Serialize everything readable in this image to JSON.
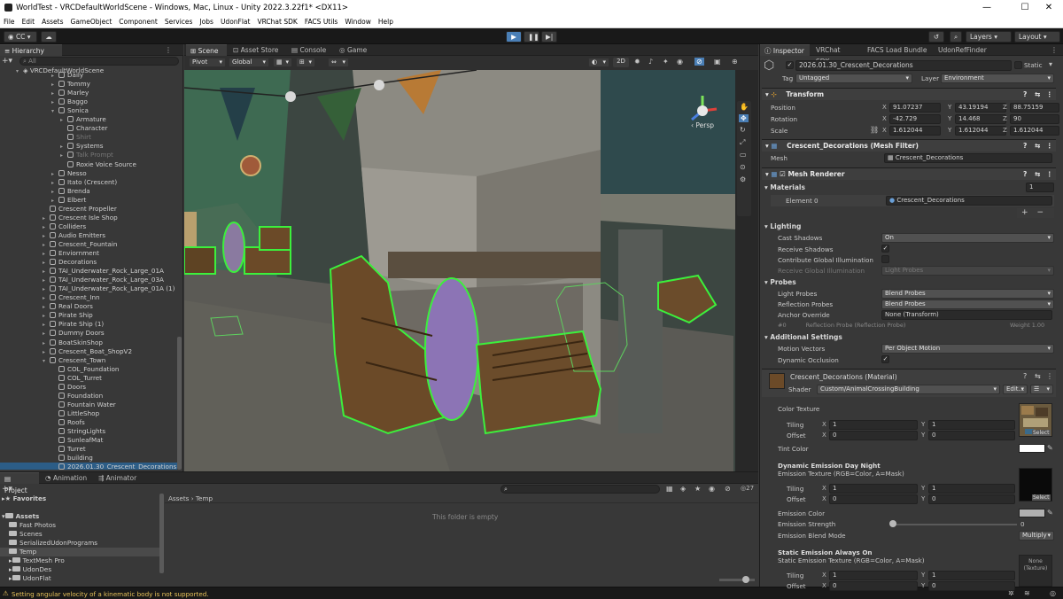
{
  "window": {
    "title": "WorldTest - VRCDefaultWorldScene - Windows, Mac, Linux - Unity 2022.3.22f1* <DX11>",
    "controls": [
      "—",
      "☐",
      "✕"
    ]
  },
  "menu": [
    "File",
    "Edit",
    "Assets",
    "GameObject",
    "Component",
    "Services",
    "Jobs",
    "UdonFlat",
    "VRChat SDK",
    "FACS Utils",
    "Window",
    "Help"
  ],
  "toolbar": {
    "account": "CC",
    "layers": "Layers",
    "layout": "Layout"
  },
  "hierarchy": {
    "tab": "Hierarchy",
    "search_placeholder": "All",
    "scene": "VRCDefaultWorldScene",
    "rows": [
      {
        "label": "Daily",
        "indent": 5,
        "dim": false,
        "fold": "▸"
      },
      {
        "label": "Tommy",
        "indent": 5,
        "fold": "▸"
      },
      {
        "label": "Marley",
        "indent": 5,
        "fold": "▸"
      },
      {
        "label": "Baggo",
        "indent": 5,
        "fold": "▸"
      },
      {
        "label": "Sonica",
        "indent": 5,
        "fold": "▾"
      },
      {
        "label": "Armature",
        "indent": 6,
        "fold": "▸"
      },
      {
        "label": "Character",
        "indent": 6,
        "fold": ""
      },
      {
        "label": "Shirt",
        "indent": 6,
        "fold": "",
        "dim": true
      },
      {
        "label": "Systems",
        "indent": 6,
        "fold": "▸"
      },
      {
        "label": "Talk Prompt",
        "indent": 6,
        "fold": "▸",
        "dim": true
      },
      {
        "label": "Roxie Voice Source",
        "indent": 6,
        "fold": ""
      },
      {
        "label": "Nesso",
        "indent": 5,
        "fold": "▸"
      },
      {
        "label": "Itato (Crescent)",
        "indent": 5,
        "fold": "▸"
      },
      {
        "label": "Brenda",
        "indent": 5,
        "fold": "▸"
      },
      {
        "label": "Elbert",
        "indent": 5,
        "fold": "▸"
      },
      {
        "label": "Crescent Propeller",
        "indent": 4,
        "fold": ""
      },
      {
        "label": "Crescent Isle Shop",
        "indent": 4,
        "fold": "▸"
      },
      {
        "label": "Colliders",
        "indent": 4,
        "fold": "▸"
      },
      {
        "label": "Audio Emitters",
        "indent": 4,
        "fold": "▸"
      },
      {
        "label": "Crescent_Fountain",
        "indent": 4,
        "fold": "▸"
      },
      {
        "label": "Enviornment",
        "indent": 4,
        "fold": "▸"
      },
      {
        "label": "Decorations",
        "indent": 4,
        "fold": "▸"
      },
      {
        "label": "TAI_Underwater_Rock_Large_01A",
        "indent": 4,
        "fold": "▸"
      },
      {
        "label": "TAI_Underwater_Rock_Large_03A",
        "indent": 4,
        "fold": "▸"
      },
      {
        "label": "TAI_Underwater_Rock_Large_01A (1)",
        "indent": 4,
        "fold": "▸"
      },
      {
        "label": "Crescent_Inn",
        "indent": 4,
        "fold": "▸"
      },
      {
        "label": "Real Doors",
        "indent": 4,
        "fold": "▸"
      },
      {
        "label": "Pirate Ship",
        "indent": 4,
        "fold": "▸"
      },
      {
        "label": "Pirate Ship (1)",
        "indent": 4,
        "fold": "▸"
      },
      {
        "label": "Dummy Doors",
        "indent": 4,
        "fold": "▸"
      },
      {
        "label": "BoatSkinShop",
        "indent": 4,
        "fold": "▸"
      },
      {
        "label": "Crescent_Boat_ShopV2",
        "indent": 4,
        "fold": "▸"
      },
      {
        "label": "Crescent_Town",
        "indent": 4,
        "fold": "▾"
      },
      {
        "label": "COL_Foundation",
        "indent": 5,
        "fold": ""
      },
      {
        "label": "COL_Turret",
        "indent": 5,
        "fold": ""
      },
      {
        "label": "Doors",
        "indent": 5,
        "fold": ""
      },
      {
        "label": "Foundation",
        "indent": 5,
        "fold": ""
      },
      {
        "label": "Fountain Water",
        "indent": 5,
        "fold": ""
      },
      {
        "label": "LittleShop",
        "indent": 5,
        "fold": ""
      },
      {
        "label": "Roofs",
        "indent": 5,
        "fold": ""
      },
      {
        "label": "StringLights",
        "indent": 5,
        "fold": ""
      },
      {
        "label": "SunleafMat",
        "indent": 5,
        "fold": ""
      },
      {
        "label": "Turret",
        "indent": 5,
        "fold": ""
      },
      {
        "label": "building",
        "indent": 5,
        "fold": ""
      },
      {
        "label": "2026.01.30_Crescent_Decorations",
        "indent": 5,
        "fold": "",
        "selected": true
      }
    ]
  },
  "scene_tabs": [
    "Scene",
    "Asset Store",
    "Console",
    "Game"
  ],
  "scene_toolbar": {
    "pivot": "Pivot",
    "global": "Global",
    "mode_2d": "2D",
    "persp": "Persp"
  },
  "bottom_tabs": [
    "Project",
    "Animation",
    "Animator"
  ],
  "project": {
    "favorites": "Favorites",
    "assets": "Assets",
    "folders": [
      "Fast Photos",
      "Scenes",
      "SerializedUdonPrograms",
      "Temp",
      "TextMesh Pro",
      "UdonDes",
      "UdonFlat"
    ],
    "breadcrumb": [
      "Assets",
      "Temp"
    ],
    "empty": "This folder is empty",
    "count": "27"
  },
  "status": {
    "message": "Setting angular velocity of a kinematic body is not supported.",
    "color": "#e8c35a"
  },
  "inspector_tabs": [
    "Inspector",
    "VRChat SDK",
    "FACS Load Bundle",
    "UdonRefFinder"
  ],
  "inspector": {
    "object_name": "2026.01.30_Crescent_Decorations",
    "static": "Static",
    "tag_label": "Tag",
    "tag": "Untagged",
    "layer_label": "Layer",
    "layer": "Environment",
    "transform": {
      "title": "Transform",
      "position": {
        "label": "Position",
        "x": "91.07237",
        "y": "43.19194",
        "z": "88.75159"
      },
      "rotation": {
        "label": "Rotation",
        "x": "-42.729",
        "y": "14.468",
        "z": "90"
      },
      "scale": {
        "label": "Scale",
        "x": "1.612044",
        "y": "1.612044",
        "z": "1.612044"
      }
    },
    "mesh_filter": {
      "title": "Crescent_Decorations (Mesh Filter)",
      "mesh_label": "Mesh",
      "mesh": "Crescent_Decorations"
    },
    "mesh_renderer": {
      "title": "Mesh Renderer",
      "materials_label": "Materials",
      "materials_count": "1",
      "element_label": "Element 0",
      "element": "Crescent_Decorations",
      "lighting_label": "Lighting",
      "cast_shadows_label": "Cast Shadows",
      "cast_shadows": "On",
      "receive_shadows_label": "Receive Shadows",
      "contrib_gi_label": "Contribute Global Illumination",
      "receive_gi_label": "Receive Global Illumination",
      "receive_gi": "Light Probes",
      "probes_label": "Probes",
      "light_probes_label": "Light Probes",
      "light_probes": "Blend Probes",
      "reflection_probes_label": "Reflection Probes",
      "reflection_probes": "Blend Probes",
      "anchor_label": "Anchor Override",
      "anchor": "None (Transform)",
      "probe_hint_index": "#0",
      "probe_hint": "Reflection Probe (Reflection Probe)",
      "probe_weight": "Weight 1.00",
      "additional_label": "Additional Settings",
      "motion_vectors_label": "Motion Vectors",
      "motion_vectors": "Per Object Motion",
      "dynamic_occlusion_label": "Dynamic Occlusion"
    },
    "material": {
      "title": "Crescent_Decorations (Material)",
      "shader_label": "Shader",
      "shader": "Custom/AnimalCrossingBuilding",
      "edit": "Edit...",
      "color_texture": "Color Texture",
      "tiling_label": "Tiling",
      "offset_label": "Offset",
      "color_tiling": {
        "x": "1",
        "y": "1"
      },
      "color_offset": {
        "x": "0",
        "y": "0"
      },
      "select": "Select",
      "tint_color": "Tint Color",
      "dyn_title": "Dynamic Emission Day Night",
      "dyn_tex": "Emission Texture (RGB=Color, A=Mask)",
      "dyn_tiling": {
        "x": "1",
        "y": "1"
      },
      "dyn_offset": {
        "x": "0",
        "y": "0"
      },
      "emission_color": "Emission Color",
      "emission_strength": "Emission Strength",
      "emission_strength_value": "0",
      "blend_mode_label": "Emission Blend Mode",
      "blend_mode": "Multiply",
      "static_title": "Static Emission Always On",
      "static_tex": "Static Emission Texture (RGB=Color, A=Mask)",
      "static_tiling": {
        "x": "1",
        "y": "1"
      },
      "static_offset": {
        "x": "0",
        "y": "0"
      },
      "none_texture": "None\n(Texture)"
    }
  }
}
